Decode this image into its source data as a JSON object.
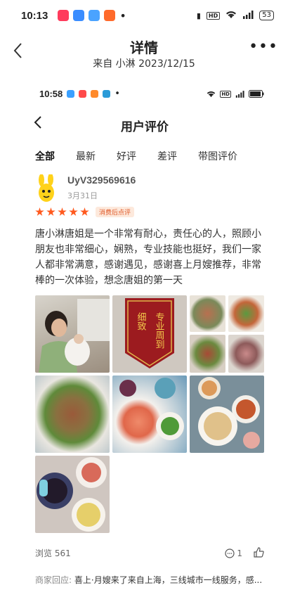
{
  "status_bar": {
    "time": "10:13",
    "battery": "53"
  },
  "header": {
    "title": "详情",
    "subtitle": "来自 小淋 2023/12/15"
  },
  "inner": {
    "status_bar": {
      "time": "10:58"
    },
    "title": "用户评价",
    "tabs": [
      "全部",
      "最新",
      "好评",
      "差评",
      "带图评价"
    ],
    "reviewer": {
      "username": "UyV329569616",
      "date": "3月31日"
    },
    "rating_stars": 5,
    "tag": "消费后点评",
    "review_text": "唐小淋唐姐是一个非常有耐心，责任心的人，照顾小朋友也非常细心，娴熟，专业技能也挺好，我们一家人都非常满意，感谢遇见，感谢喜上月嫂推荐，非常棒的一次体验，想念唐姐的第一天",
    "banner_text": {
      "right": "专业周到",
      "left": "细致"
    },
    "views": "浏览 561",
    "comments": "1",
    "merchant_reply_label": "商家回应:",
    "merchant_reply": "喜上·月嫂来了来自上海，三线城市一线服务，感..."
  },
  "colors": {
    "accent": "#ff5a1f",
    "tag_bg": "#fde9dc"
  }
}
